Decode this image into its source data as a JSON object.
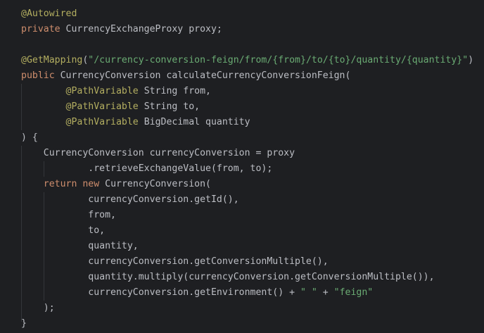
{
  "editor": {
    "language": "Java",
    "theme_colors": {
      "background": "#1e1f22",
      "default_text": "#bcbec4",
      "keyword": "#cf8e6d",
      "annotation": "#b3ae60",
      "string": "#6aab73",
      "indent_guide": "#34363a"
    },
    "lines": [
      {
        "indent": "",
        "tokens": [
          {
            "kind": "annotation",
            "text": "@Autowired"
          }
        ]
      },
      {
        "indent": "",
        "tokens": [
          {
            "kind": "keyword",
            "text": "private"
          },
          {
            "kind": "plain",
            "text": " CurrencyExchangeProxy proxy;"
          }
        ]
      },
      {
        "indent": "",
        "tokens": []
      },
      {
        "indent": "",
        "tokens": [
          {
            "kind": "annotation",
            "text": "@GetMapping"
          },
          {
            "kind": "plain",
            "text": "("
          },
          {
            "kind": "string",
            "text": "\"/currency-conversion-feign/from/{from}/to/{to}/quantity/{quantity}\""
          },
          {
            "kind": "plain",
            "text": ")"
          }
        ]
      },
      {
        "indent": "",
        "tokens": [
          {
            "kind": "keyword",
            "text": "public"
          },
          {
            "kind": "plain",
            "text": " CurrencyConversion calculateCurrencyConversionFeign("
          }
        ]
      },
      {
        "indent": "        ",
        "tokens": [
          {
            "kind": "annotation",
            "text": "@PathVariable"
          },
          {
            "kind": "plain",
            "text": " String from,"
          }
        ]
      },
      {
        "indent": "        ",
        "tokens": [
          {
            "kind": "annotation",
            "text": "@PathVariable"
          },
          {
            "kind": "plain",
            "text": " String to,"
          }
        ]
      },
      {
        "indent": "        ",
        "tokens": [
          {
            "kind": "annotation",
            "text": "@PathVariable"
          },
          {
            "kind": "plain",
            "text": " BigDecimal quantity"
          }
        ]
      },
      {
        "indent": "",
        "tokens": [
          {
            "kind": "plain",
            "text": ") {"
          }
        ]
      },
      {
        "indent": "    ",
        "tokens": [
          {
            "kind": "plain",
            "text": "CurrencyConversion currencyConversion = proxy"
          }
        ]
      },
      {
        "indent": "            ",
        "tokens": [
          {
            "kind": "plain",
            "text": ".retrieveExchangeValue(from, to);"
          }
        ]
      },
      {
        "indent": "    ",
        "tokens": [
          {
            "kind": "keyword",
            "text": "return"
          },
          {
            "kind": "plain",
            "text": " "
          },
          {
            "kind": "keyword",
            "text": "new"
          },
          {
            "kind": "plain",
            "text": " CurrencyConversion("
          }
        ]
      },
      {
        "indent": "            ",
        "tokens": [
          {
            "kind": "plain",
            "text": "currencyConversion.getId(),"
          }
        ]
      },
      {
        "indent": "            ",
        "tokens": [
          {
            "kind": "plain",
            "text": "from,"
          }
        ]
      },
      {
        "indent": "            ",
        "tokens": [
          {
            "kind": "plain",
            "text": "to,"
          }
        ]
      },
      {
        "indent": "            ",
        "tokens": [
          {
            "kind": "plain",
            "text": "quantity,"
          }
        ]
      },
      {
        "indent": "            ",
        "tokens": [
          {
            "kind": "plain",
            "text": "currencyConversion.getConversionMultiple(),"
          }
        ]
      },
      {
        "indent": "            ",
        "tokens": [
          {
            "kind": "plain",
            "text": "quantity.multiply(currencyConversion.getConversionMultiple()),"
          }
        ]
      },
      {
        "indent": "            ",
        "tokens": [
          {
            "kind": "plain",
            "text": "currencyConversion.getEnvironment() + "
          },
          {
            "kind": "string",
            "text": "\" \""
          },
          {
            "kind": "plain",
            "text": " + "
          },
          {
            "kind": "string",
            "text": "\"feign\""
          }
        ]
      },
      {
        "indent": "    ",
        "tokens": [
          {
            "kind": "plain",
            "text": ");"
          }
        ]
      },
      {
        "indent": "",
        "tokens": [
          {
            "kind": "plain",
            "text": "}"
          }
        ]
      }
    ]
  }
}
